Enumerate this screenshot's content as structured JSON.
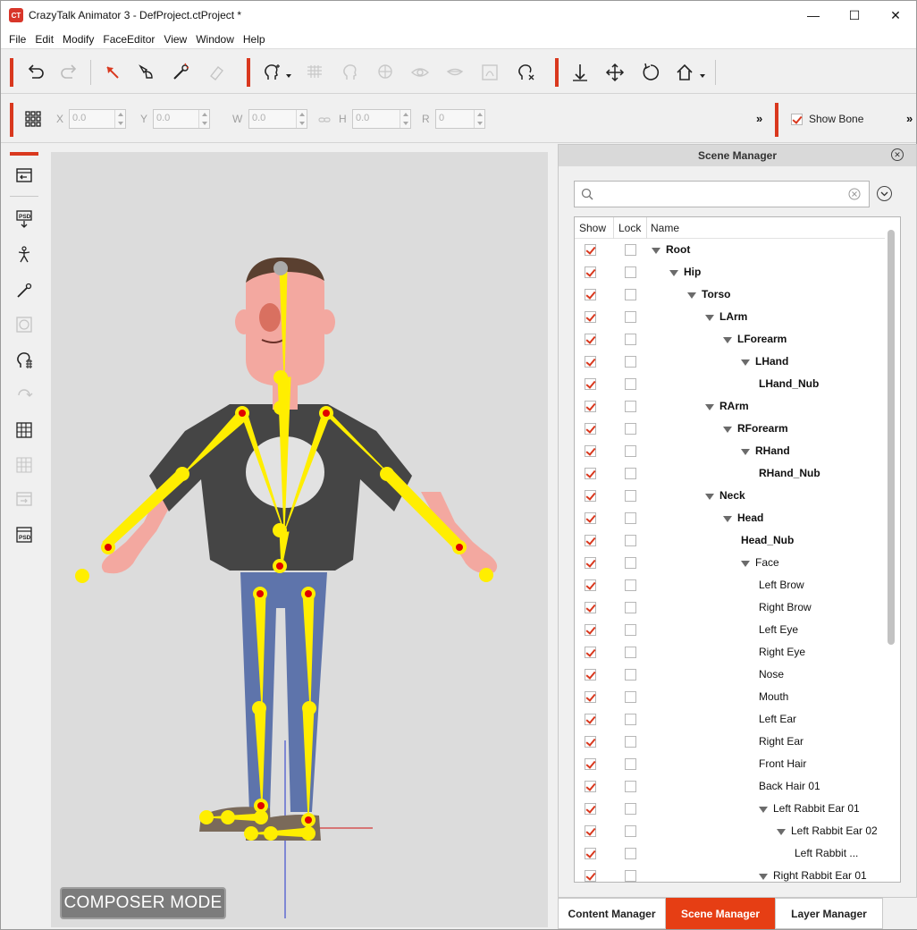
{
  "window": {
    "app_icon": "CT",
    "title": "CrazyTalk Animator 3   - DefProject.ctProject *",
    "controls": {
      "minimize": "—",
      "maximize": "☐",
      "close": "✕"
    }
  },
  "menu": [
    "File",
    "Edit",
    "Modify",
    "FaceEditor",
    "View",
    "Window",
    "Help"
  ],
  "toolbar": {
    "icons": [
      "undo-icon",
      "redo-icon",
      "select-icon",
      "bone-transform-icon",
      "bone-edit-icon",
      "eraser-icon",
      "head-sprite-icon",
      "mesh-icon",
      "face-icon",
      "face-key-icon",
      "eye-icon",
      "mouth-icon",
      "deform-icon",
      "reset-face-icon",
      "move-down-icon",
      "move-icon",
      "rotate-icon",
      "home-icon"
    ]
  },
  "transform": {
    "x_label": "X",
    "x_value": "0.0",
    "y_label": "Y",
    "y_value": "0.0",
    "w_label": "W",
    "w_value": "0.0",
    "h_label": "H",
    "h_value": "0.0",
    "r_label": "R",
    "r_value": "0",
    "more": "»",
    "show_bone_label": "Show Bone",
    "show_bone_checked": true
  },
  "viewport": {
    "mode_label": "COMPOSER MODE"
  },
  "scene_manager": {
    "title": "Scene Manager",
    "columns": {
      "show": "Show",
      "lock": "Lock",
      "name": "Name"
    },
    "rows": [
      {
        "name": "Root",
        "depth": 0,
        "expanded": true,
        "bold": true
      },
      {
        "name": "Hip",
        "depth": 1,
        "expanded": true,
        "bold": true
      },
      {
        "name": "Torso",
        "depth": 2,
        "expanded": true,
        "bold": true
      },
      {
        "name": "LArm",
        "depth": 3,
        "expanded": true,
        "bold": true
      },
      {
        "name": "LForearm",
        "depth": 4,
        "expanded": true,
        "bold": true
      },
      {
        "name": "LHand",
        "depth": 5,
        "expanded": true,
        "bold": true
      },
      {
        "name": "LHand_Nub",
        "depth": 6,
        "expanded": false,
        "bold": true
      },
      {
        "name": "RArm",
        "depth": 3,
        "expanded": true,
        "bold": true
      },
      {
        "name": "RForearm",
        "depth": 4,
        "expanded": true,
        "bold": true
      },
      {
        "name": "RHand",
        "depth": 5,
        "expanded": true,
        "bold": true
      },
      {
        "name": "RHand_Nub",
        "depth": 6,
        "expanded": false,
        "bold": true
      },
      {
        "name": "Neck",
        "depth": 3,
        "expanded": true,
        "bold": true
      },
      {
        "name": "Head",
        "depth": 4,
        "expanded": true,
        "bold": true
      },
      {
        "name": "Head_Nub",
        "depth": 5,
        "expanded": false,
        "bold": true
      },
      {
        "name": "Face",
        "depth": 5,
        "expanded": true,
        "bold": false
      },
      {
        "name": "Left Brow",
        "depth": 6,
        "expanded": false,
        "bold": false
      },
      {
        "name": "Right Brow",
        "depth": 6,
        "expanded": false,
        "bold": false
      },
      {
        "name": "Left Eye",
        "depth": 6,
        "expanded": false,
        "bold": false
      },
      {
        "name": "Right Eye",
        "depth": 6,
        "expanded": false,
        "bold": false
      },
      {
        "name": "Nose",
        "depth": 6,
        "expanded": false,
        "bold": false
      },
      {
        "name": "Mouth",
        "depth": 6,
        "expanded": false,
        "bold": false
      },
      {
        "name": "Left Ear",
        "depth": 6,
        "expanded": false,
        "bold": false
      },
      {
        "name": "Right Ear",
        "depth": 6,
        "expanded": false,
        "bold": false
      },
      {
        "name": "Front Hair",
        "depth": 6,
        "expanded": false,
        "bold": false
      },
      {
        "name": "Back Hair 01",
        "depth": 6,
        "expanded": false,
        "bold": false
      },
      {
        "name": "Left Rabbit Ear 01",
        "depth": 6,
        "expanded": true,
        "bold": false,
        "has_children": true
      },
      {
        "name": "Left Rabbit Ear 02",
        "depth": 7,
        "expanded": true,
        "bold": false,
        "has_children": true
      },
      {
        "name": "Left Rabbit ...",
        "depth": 8,
        "expanded": false,
        "bold": false
      },
      {
        "name": "Right Rabbit Ear 01",
        "depth": 6,
        "expanded": true,
        "bold": false,
        "has_children": true
      }
    ]
  },
  "tabs": [
    {
      "label": "Content Manager",
      "active": false
    },
    {
      "label": "Scene Manager",
      "active": true
    },
    {
      "label": "Layer Manager",
      "active": false
    }
  ],
  "colors": {
    "accent": "#e63e14",
    "bone": "#ffee00",
    "joint": "#e00000"
  }
}
